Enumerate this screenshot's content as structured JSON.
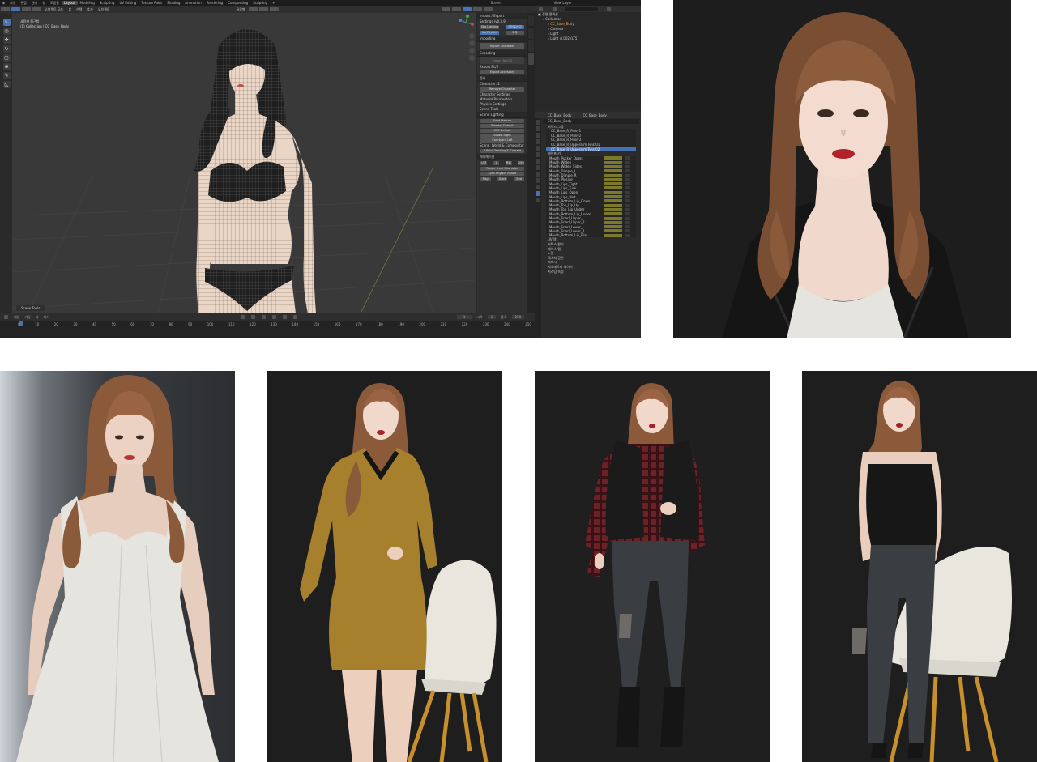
{
  "blender": {
    "menu": [
      "파일",
      "편집",
      "렌더",
      "창",
      "도움말"
    ],
    "workspaces": [
      "Layout",
      "Modeling",
      "Sculpting",
      "UV Editing",
      "Texture Paint",
      "Shading",
      "Animation",
      "Rendering",
      "Compositing",
      "Scripting"
    ],
    "active_workspace": "Layout",
    "scene_label": "Scene",
    "view_layer_label": "View Layer",
    "viewport": {
      "mode": "오브젝트 모드",
      "menus": [
        "뷰",
        "선택",
        "추가",
        "오브젝트"
      ],
      "orientation": "글로벌",
      "title_line1": "사용자 원근법",
      "title_line2": "(1) Collection | CC_Base_Body"
    },
    "npanel": {
      "header": "Import / Export",
      "settings": "Settings (v0.3.9)",
      "lighting_btns": [
        "Ska Lighting",
        "레이트레이"
      ],
      "physics_btns": [
        "No Physics",
        "모두"
      ],
      "importing": "Importing",
      "import_character": "Import Character",
      "exporting": "Exporting",
      "export_cc3": "Export To CC3",
      "export_rl": "Export RL/E",
      "export_accessory": "Export Accessory",
      "clean_up": "정리",
      "character_label": "Character: 1",
      "remove_character": "Remove Character",
      "sections": [
        "Character Settings",
        "Material Parameters",
        "Physics Settings",
        "Scene Tools"
      ],
      "scene_lighting": "Scene Lighting",
      "lighting_presets": [
        "Solid Matcap",
        "Blender Default",
        "CC3 Default",
        "Studio Right",
        "Courtyard Left"
      ],
      "scene_world": "Scene, World & Compositor",
      "orbit_camera": "3 Point Tracking & Camera",
      "animation": "애니메이션",
      "anim_row": [
        "시작",
        "1",
        "종료",
        "250"
      ],
      "range_from_character": "Range From Character",
      "sync_physics": "Sync Physics Range",
      "play_buttons": [
        "Play",
        "Start",
        "End"
      ]
    },
    "outliner": {
      "tabs": [
        "장면 컬렉션"
      ],
      "items": [
        "Collection",
        "CC_Base_Body",
        "Camera",
        "Light",
        "Light_rl.002 (LT5)"
      ]
    },
    "properties": {
      "object_name": "CC_Base_Body",
      "data_name": "CC_Base_Body",
      "mesh_name": "CC_Base_Body",
      "vertex_groups": "버텍스 그룹",
      "groups": [
        "CC_Base_R_Pinky1",
        "CC_Base_R_Pinky2",
        "CC_Base_R_Pinky3",
        "CC_Base_R_Upperarm Twist01",
        "CC_Base_R_Upperarm Twist02"
      ],
      "shape_keys": "셰이프 키",
      "keys": [
        "Mouth_Pucker_Open",
        "Mouth_Widen",
        "Mouth_Widen_Sides",
        "Mouth_Dimple_L",
        "Mouth_Dimple_R",
        "Mouth_Plosive",
        "Mouth_Lips_Tight",
        "Mouth_Lips_Tuck",
        "Mouth_Lips_Open",
        "Mouth_Lips_Part",
        "Mouth_Bottom_Lip_Down",
        "Mouth_Top_Lip_Up",
        "Mouth_Top_Lip_Under",
        "Mouth_Bottom_Lip_Under",
        "Mouth_Snarl_Upper_L",
        "Mouth_Snarl_Upper_R",
        "Mouth_Snarl_Lower_L",
        "Mouth_Snarl_Lower_R",
        "Mouth_Bottom_Lip_Bias"
      ],
      "panels": [
        "UV 맵",
        "버텍스 컬러",
        "페이스 맵",
        "노멀",
        "텍스처 공간",
        "리메시",
        "지오메트리 데이터",
        "커스텀 속성"
      ]
    },
    "timeline": {
      "menus": [
        "재생",
        "키잉",
        "뷰",
        "마커"
      ],
      "ticks": [
        "0",
        "10",
        "20",
        "30",
        "40",
        "50",
        "60",
        "70",
        "80",
        "90",
        "100",
        "110",
        "120",
        "130",
        "140",
        "150",
        "160",
        "170",
        "180",
        "190",
        "200",
        "210",
        "220",
        "230",
        "240",
        "250"
      ],
      "current_frame": "1",
      "start": "시작",
      "start_val": "1",
      "end": "종료",
      "end_val": "250",
      "scene_tools": "Scene Tools"
    }
  },
  "images": [
    {
      "name": "portrait",
      "caption": ""
    },
    {
      "name": "white-dress",
      "caption": ""
    },
    {
      "name": "yellow-dress",
      "caption": ""
    },
    {
      "name": "plaid-shirt",
      "caption": ""
    },
    {
      "name": "black-top",
      "caption": ""
    }
  ],
  "colors": {
    "accent_blue": "#4772b3",
    "shape_key_bar": "#7a7a2a",
    "hair": "#8a5a3a",
    "skin": "#e8c8b4",
    "dress_yellow": "#a6802c",
    "dress_white": "#e4e2dc",
    "shirt_plaid": "#6b2228",
    "jeans": "#3a3d42",
    "chair": "#e8e6dc"
  }
}
